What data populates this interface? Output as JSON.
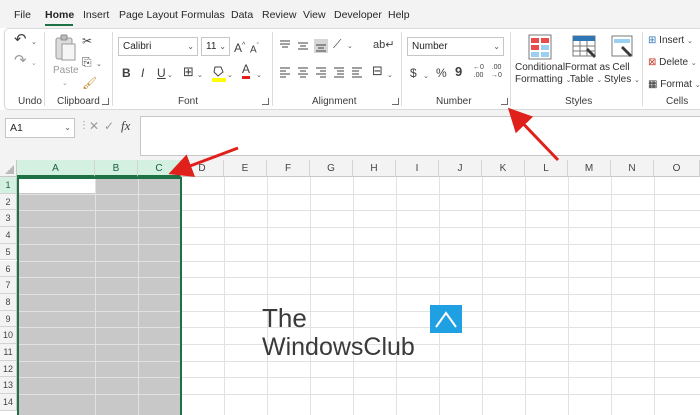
{
  "menu": {
    "tabs": [
      "File",
      "Home",
      "Insert",
      "Page Layout",
      "Formulas",
      "Data",
      "Review",
      "View",
      "Developer",
      "Help"
    ],
    "active": "Home"
  },
  "ribbon": {
    "undo": {
      "label": "Undo"
    },
    "clipboard": {
      "paste_label": "Paste",
      "label": "Clipboard"
    },
    "font": {
      "name": "Calibri",
      "size": "11",
      "grow": "A",
      "shrink": "A",
      "label": "Font"
    },
    "alignment": {
      "label": "Alignment"
    },
    "number": {
      "format": "Number",
      "currency": "$",
      "percent": "%",
      "comma": "9",
      "inc_decimal": "←0 .00",
      "dec_decimal": ".00 →0",
      "label": "Number"
    },
    "styles": {
      "conditional_line1": "Conditional",
      "conditional_line2": "Formatting",
      "format_table_line1": "Format as",
      "format_table_line2": "Table",
      "cell_styles_line1": "Cell",
      "cell_styles_line2": "Styles",
      "label": "Styles"
    },
    "cells": {
      "insert": "Insert",
      "delete": "Delete",
      "format": "Format",
      "label": "Cells"
    }
  },
  "formula_bar": {
    "name_box": "A1",
    "fx": "fx",
    "value": ""
  },
  "sheet": {
    "columns": [
      "A",
      "B",
      "C",
      "D",
      "E",
      "F",
      "G",
      "H",
      "I",
      "J",
      "K",
      "L",
      "M",
      "N",
      "O"
    ],
    "rows": [
      "1",
      "2",
      "3",
      "4",
      "5",
      "6",
      "7",
      "8",
      "9",
      "10",
      "11",
      "12",
      "13",
      "14"
    ],
    "selected_columns": [
      "A",
      "B",
      "C"
    ],
    "active_cell": "A1"
  },
  "watermark": {
    "line1": "The",
    "line2": "WindowsClub"
  },
  "colors": {
    "accent": "#1e7145",
    "selection": "#c8c8c8",
    "arrow": "#e0201b",
    "logo": "#1fa0e3"
  }
}
